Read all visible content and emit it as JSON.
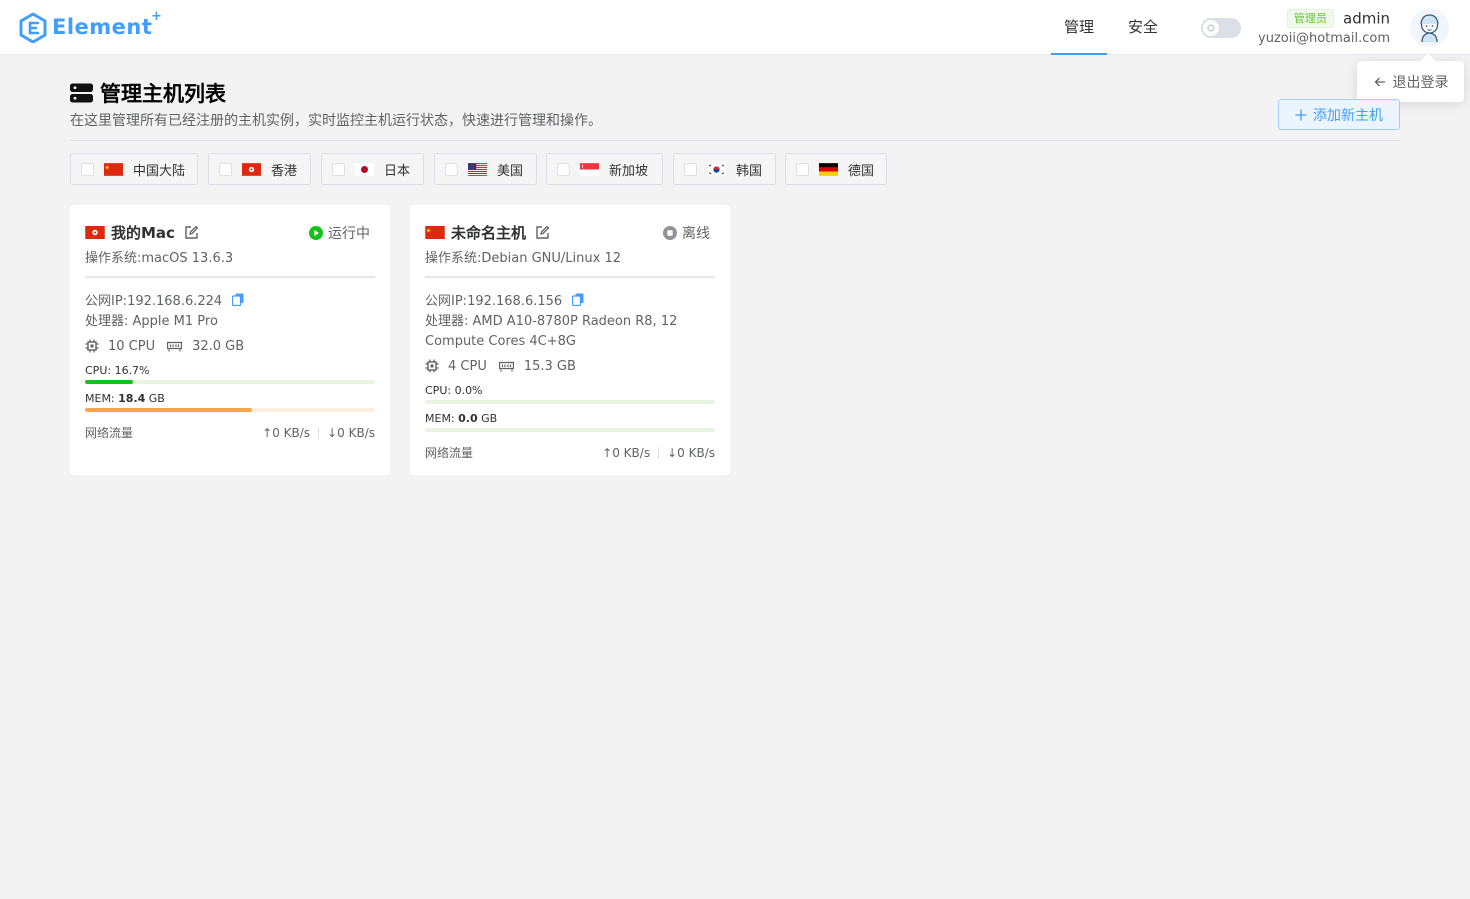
{
  "header": {
    "logo_text": "Element",
    "logo_sup": "+",
    "nav": [
      {
        "label": "管理",
        "active": true
      },
      {
        "label": "安全",
        "active": false
      }
    ],
    "user": {
      "role_tag": "管理员",
      "name": "admin",
      "email": "yuzoii@hotmail.com"
    },
    "logout_label": "退出登录"
  },
  "page": {
    "title": "管理主机列表",
    "subtitle": "在这里管理所有已经注册的主机实例，实时监控主机运行状态，快速进行管理和操作。",
    "add_button": "添加新主机"
  },
  "filters": [
    {
      "label": "中国大陆",
      "flag": "cn"
    },
    {
      "label": "香港",
      "flag": "hk"
    },
    {
      "label": "日本",
      "flag": "jp"
    },
    {
      "label": "美国",
      "flag": "us"
    },
    {
      "label": "新加坡",
      "flag": "sg"
    },
    {
      "label": "韩国",
      "flag": "kr"
    },
    {
      "label": "德国",
      "flag": "de"
    }
  ],
  "hosts": [
    {
      "name": "我的Mac",
      "flag": "hk",
      "status": "运行中",
      "status_color": "#67c23a",
      "os_label": "操作系统:",
      "os": "macOS 13.6.3",
      "ip_label": "公网IP:",
      "ip": "192.168.6.224",
      "cpu_label": "处理器:",
      "cpu_model": "Apple M1 Pro",
      "cpu_count": "10 CPU",
      "memory": "32.0 GB",
      "cpu_usage_label": "CPU: 16.7%",
      "cpu_usage": 0.167,
      "mem_prefix": "MEM: ",
      "mem_used": "18.4",
      "mem_unit": " GB",
      "mem_usage": 0.575,
      "net_label": "网络流量",
      "net_up": "0 KB/s",
      "net_down": "0 KB/s"
    },
    {
      "name": "未命名主机",
      "flag": "cn",
      "status": "离线",
      "status_color": "#909399",
      "os_label": "操作系统:",
      "os": "Debian GNU/Linux 12",
      "ip_label": "公网IP:",
      "ip": "192.168.6.156",
      "cpu_label": "处理器:",
      "cpu_model": "AMD A10-8780P Radeon R8, 12 Compute Cores 4C+8G",
      "cpu_count": "4 CPU",
      "memory": "15.3 GB",
      "cpu_usage_label": "CPU: 0.0%",
      "cpu_usage": 0.0,
      "mem_prefix": "MEM: ",
      "mem_used": "0.0",
      "mem_unit": " GB",
      "mem_usage": 0.0,
      "net_label": "网络流量",
      "net_up": "0 KB/s",
      "net_down": "0 KB/s"
    }
  ],
  "colors": {
    "accent": "#409eff",
    "cpu_bar": "#67c23a",
    "mem_bar": "#f5a54a",
    "running": "#67c23a",
    "offline": "#909399"
  }
}
